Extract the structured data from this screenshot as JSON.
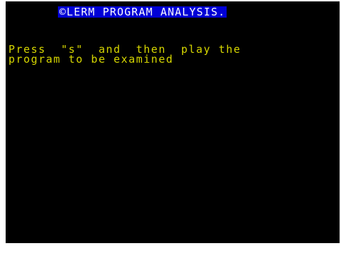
{
  "screen": {
    "title": "©LERM PROGRAM ANALYSIS.",
    "message_line_1": "Press  \"s\"  and  then  play the",
    "message_line_2": "program to be examined"
  },
  "colors": {
    "border": "#ffffff",
    "screen_background": "#000000",
    "title_background": "#0000d7",
    "title_text": "#ffffff",
    "message_text": "#d7d700"
  }
}
